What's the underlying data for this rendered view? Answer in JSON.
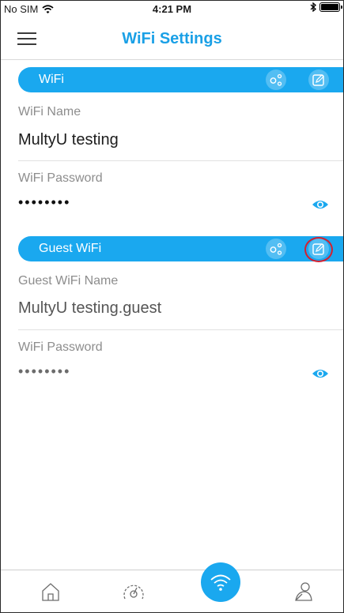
{
  "status_bar": {
    "carrier": "No SIM",
    "time": "4:21 PM"
  },
  "header": {
    "title": "WiFi Settings"
  },
  "wifi": {
    "section_label": "WiFi",
    "name_label": "WiFi Name",
    "name_value": "MultyU testing",
    "password_label": "WiFi Password",
    "password_masked": "••••••••"
  },
  "guest": {
    "section_label": "Guest WiFi",
    "name_label": "Guest WiFi Name",
    "name_value": "MultyU testing.guest",
    "password_label": "WiFi Password",
    "password_masked": "••••••••"
  },
  "colors": {
    "accent": "#1aa8ef",
    "title": "#1aa0e6",
    "highlight": "#d42030"
  },
  "tabbar": {
    "tabs": [
      "home-icon",
      "speedometer-icon",
      "wifi-icon",
      "user-icon"
    ],
    "active": "wifi-icon"
  }
}
